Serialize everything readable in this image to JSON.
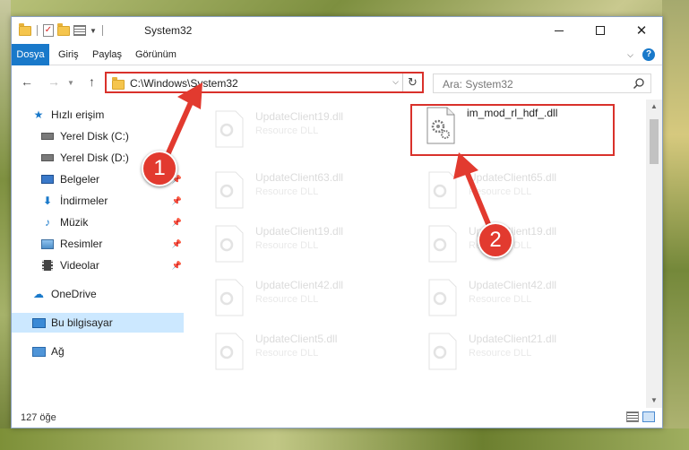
{
  "window": {
    "title": "System32",
    "address_path": "C:\\Windows\\System32",
    "search_placeholder": "Ara: System32"
  },
  "ribbon": {
    "tabs": [
      "Dosya",
      "Giriş",
      "Paylaş",
      "Görünüm"
    ]
  },
  "sidebar": {
    "items": [
      {
        "label": "Hızlı erişim",
        "icon": "star-icon",
        "pinned": false
      },
      {
        "label": "Yerel Disk (C:)",
        "icon": "drive-icon",
        "pinned": false
      },
      {
        "label": "Yerel Disk (D:)",
        "icon": "drive-icon",
        "pinned": false
      },
      {
        "label": "Belgeler",
        "icon": "documents-icon",
        "pinned": true
      },
      {
        "label": "İndirmeler",
        "icon": "download-icon",
        "pinned": true
      },
      {
        "label": "Müzik",
        "icon": "music-icon",
        "pinned": true
      },
      {
        "label": "Resimler",
        "icon": "pictures-icon",
        "pinned": true
      },
      {
        "label": "Videolar",
        "icon": "videos-icon",
        "pinned": true
      },
      {
        "label": "OneDrive",
        "icon": "onedrive-icon",
        "pinned": false
      },
      {
        "label": "Bu bilgisayar",
        "icon": "this-pc-icon",
        "pinned": false,
        "selected": true
      },
      {
        "label": "Ağ",
        "icon": "network-icon",
        "pinned": false
      }
    ]
  },
  "files": {
    "highlighted": {
      "name": "im_mod_rl_hdf_.dll"
    },
    "left_column": [
      {
        "name": "UpdateClient19.dll",
        "type": "Resource DLL"
      },
      {
        "name": "UpdateClient63.dll",
        "type": "Resource DLL"
      },
      {
        "name": "UpdateClient19.dll",
        "type": "Resource DLL"
      },
      {
        "name": "UpdateClient42.dll",
        "type": "Resource DLL"
      },
      {
        "name": "UpdateClient5.dll",
        "type": "Resource DLL"
      }
    ],
    "right_column": [
      {
        "name": "UpdateClient65.dll",
        "type": "Resource DLL"
      },
      {
        "name": "UpdateClient19.dll",
        "type": "Resource DLL"
      },
      {
        "name": "UpdateClient42.dll",
        "type": "Resource DLL"
      },
      {
        "name": "UpdateClient21.dll",
        "type": "Resource DLL"
      }
    ]
  },
  "status": {
    "item_count": "127 öğe"
  },
  "annotations": {
    "step1": "1",
    "step2": "2",
    "color": "#e23a2f"
  }
}
